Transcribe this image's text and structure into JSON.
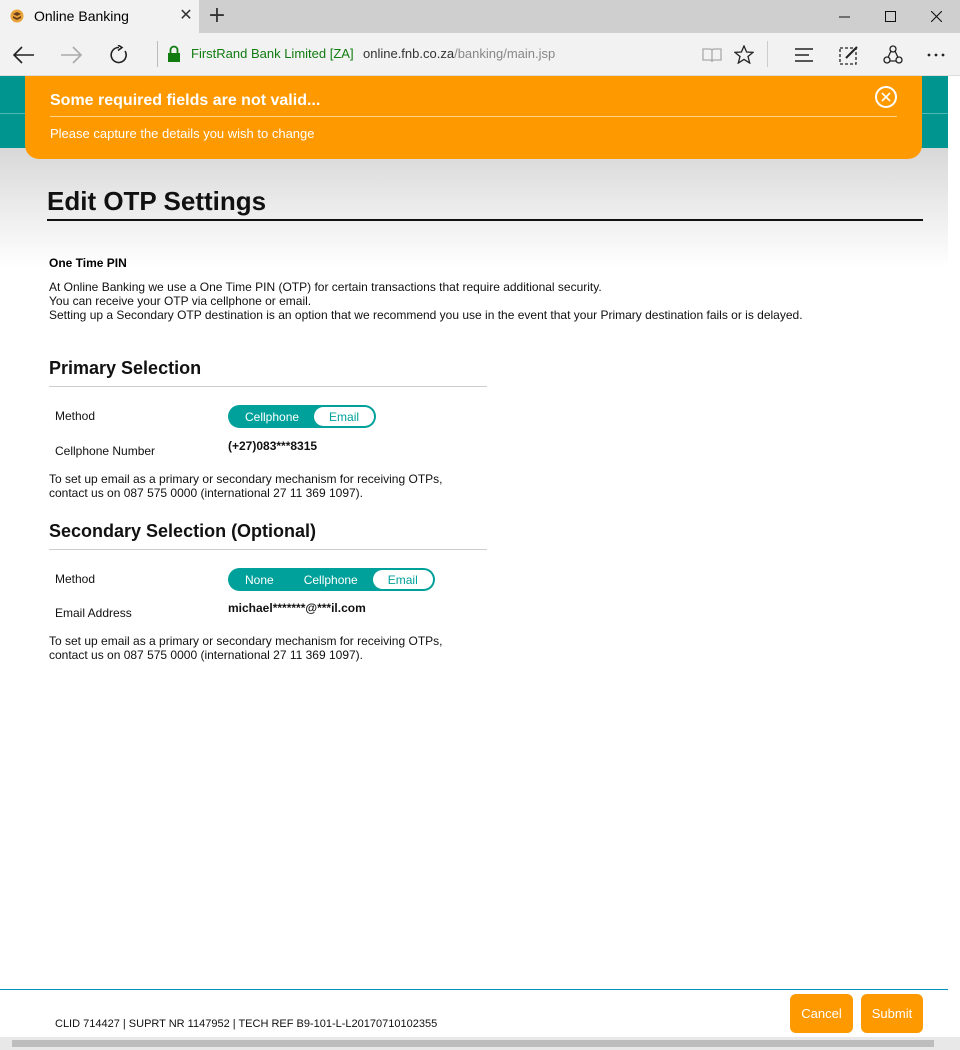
{
  "browser": {
    "tab_title": "Online Banking",
    "site_identity": "FirstRand Bank Limited [ZA]",
    "url_domain": "online.fnb.co.za",
    "url_path": "/banking/main.jsp"
  },
  "alert": {
    "title": "Some required fields are not valid...",
    "message": "Please capture the details you wish to change",
    "color": "#ff9900"
  },
  "page": {
    "title": "Edit OTP Settings",
    "otp_heading": "One Time PIN",
    "intro_lines": [
      "At Online Banking we use a One Time PIN (OTP) for certain transactions that require additional security.",
      "You can receive your OTP via cellphone or email.",
      "Setting up a Secondary OTP destination is an option that we recommend you use in the event that your Primary destination fails or is delayed."
    ]
  },
  "primary": {
    "title": "Primary Selection",
    "method_label": "Method",
    "options": [
      "Cellphone",
      "Email"
    ],
    "selected": "Email",
    "field_label": "Cellphone Number",
    "field_value": "(+27)083***8315",
    "note_lines": [
      "To set up email as a primary or secondary mechanism for receiving OTPs,",
      "contact us on 087 575 0000 (international 27 11 369 1097)."
    ]
  },
  "secondary": {
    "title": "Secondary Selection (Optional)",
    "method_label": "Method",
    "options": [
      "None",
      "Cellphone",
      "Email"
    ],
    "selected": "Email",
    "field_label": "Email Address",
    "field_value": "michael*******@***il.com",
    "note_lines": [
      "To set up email as a primary or secondary mechanism for receiving OTPs,",
      "contact us on 087 575 0000 (international 27 11 369 1097)."
    ]
  },
  "footer": {
    "reference": "CLID 714427 | SUPRT NR 1147952 | TECH REF B9-101-L-L20170710102355",
    "cancel_label": "Cancel",
    "submit_label": "Submit"
  },
  "colors": {
    "brand_teal": "#00968f",
    "accent_orange": "#ff9900",
    "toggle_teal": "#00a19a"
  }
}
